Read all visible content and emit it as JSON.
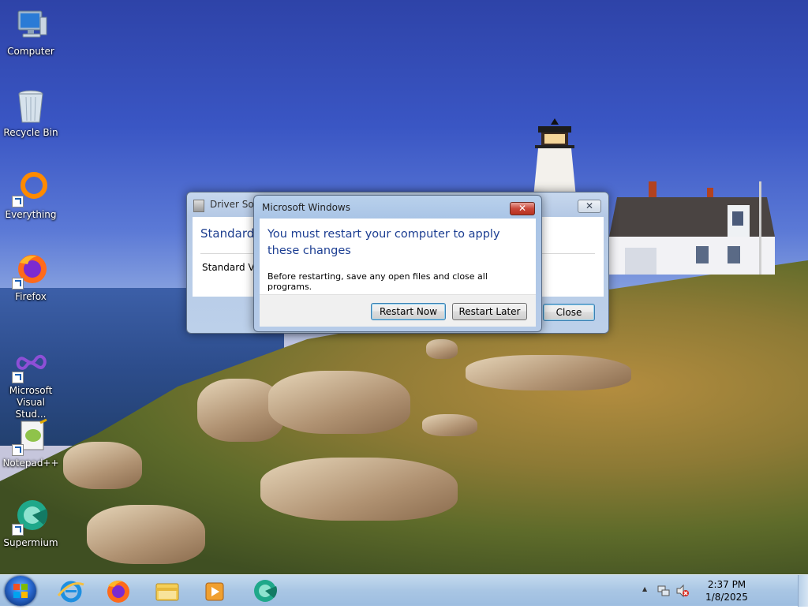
{
  "desktop": {
    "icons": [
      {
        "label": "Computer",
        "icon": "computer-icon"
      },
      {
        "label": "Recycle Bin",
        "icon": "recycle-bin-icon"
      },
      {
        "label": "Everything",
        "icon": "everything-icon"
      },
      {
        "label": "Firefox",
        "icon": "firefox-icon"
      },
      {
        "label": "Microsoft Visual Stud...",
        "icon": "visual-studio-icon"
      },
      {
        "label": "Notepad++",
        "icon": "notepad-plus-plus-icon"
      },
      {
        "label": "Supermium",
        "icon": "supermium-icon"
      }
    ]
  },
  "driver_dialog": {
    "title": "Driver Soft",
    "heading": "Standard",
    "item": "Standard VG",
    "close_label": "Close",
    "close_x": "✕"
  },
  "restart_dialog": {
    "title": "Microsoft Windows",
    "heading": "You must restart your computer to apply these changes",
    "message": "Before restarting, save any open files and close all programs.",
    "restart_now_label": "Restart Now",
    "restart_later_label": "Restart Later",
    "close_x": "✕"
  },
  "taskbar": {
    "pinned": [
      {
        "name": "internet-explorer-icon"
      },
      {
        "name": "firefox-icon"
      },
      {
        "name": "file-explorer-icon"
      },
      {
        "name": "media-player-icon"
      },
      {
        "name": "supermium-icon"
      }
    ],
    "clock": {
      "time": "2:37 PM",
      "date": "1/8/2025"
    },
    "tray_arrow": "▲"
  }
}
